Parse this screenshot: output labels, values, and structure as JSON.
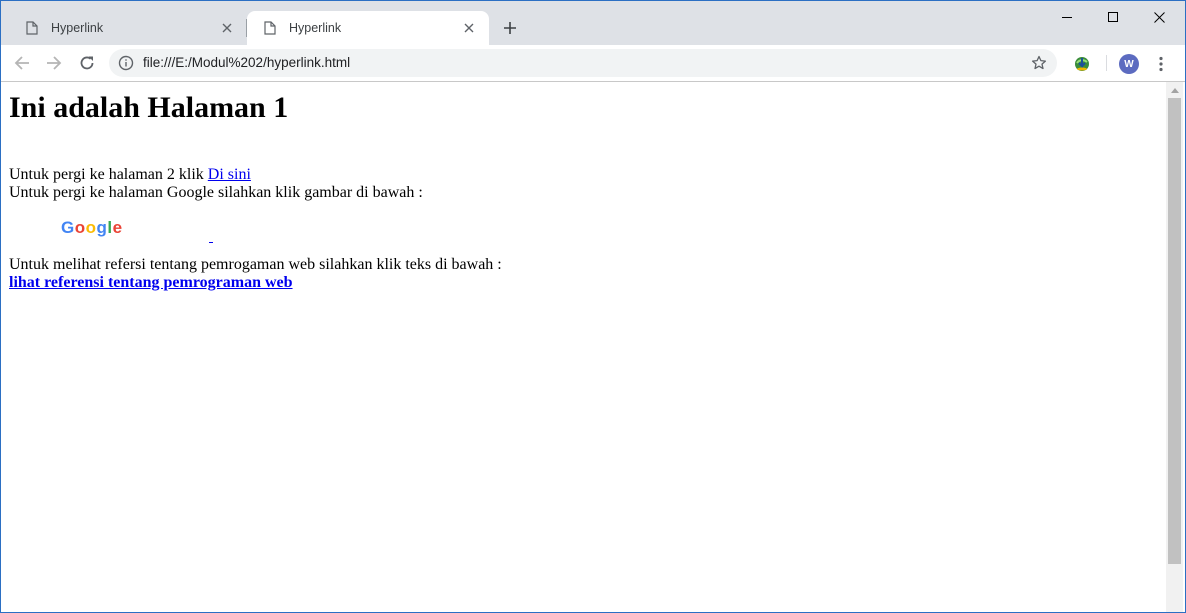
{
  "browser": {
    "tabs": [
      {
        "title": "Hyperlink",
        "active": false
      },
      {
        "title": "Hyperlink",
        "active": true
      }
    ],
    "address": "file:///E:/Modul%202/hyperlink.html",
    "avatar_initial": "W",
    "accent": "#5c6bc0"
  },
  "page": {
    "heading": "Ini adalah Halaman 1",
    "line1_text": "Untuk pergi ke halaman 2 klik ",
    "line1_link": "Di sini ",
    "line2_text": "Untuk pergi ke halaman Google silahkan klik gambar di bawah :",
    "google_logo_alt": "Google",
    "line4_text": "Untuk melihat refersi tentang pemrogaman web silahkan klik teks di bawah :",
    "line5_link": "lihat referensi tentang pemrograman web",
    "link_color": "#0000ee"
  }
}
